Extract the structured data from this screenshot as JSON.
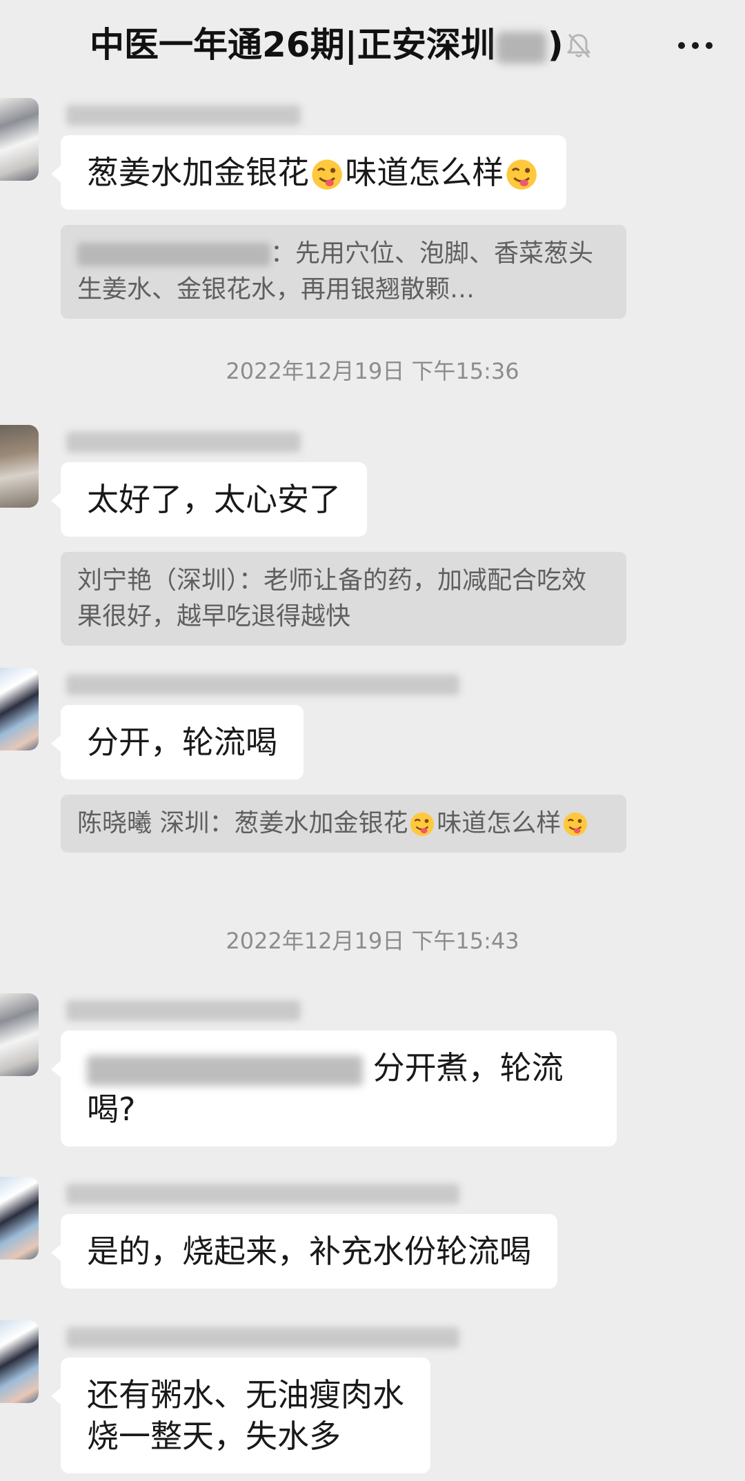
{
  "header": {
    "title": "中医一年通26期|正安深圳",
    "title_close": ")",
    "mute_icon": "bell-off-icon",
    "more_icon": "more-dots-icon"
  },
  "colors": {
    "background": "#ededed",
    "bubble": "#ffffff",
    "quote_bg": "#dcdcdc",
    "timestamp_text": "#8c8c8c"
  },
  "messages": [
    {
      "segments": [
        "葱姜水加金银花",
        "味道怎么样"
      ],
      "emojis": [
        "winking-tongue-emoji",
        "winking-tongue-emoji"
      ],
      "quote": {
        "text": "：先用穴位、泡脚、香菜葱头生姜水、金银花水，再用银翘散颗…"
      }
    },
    {
      "text": "太好了，太心安了",
      "quote": {
        "sender": "刘宁艳（深圳）：",
        "text": "老师让备的药，加减配合吃效果很好，越早吃退得越快"
      }
    },
    {
      "text": "分开，轮流喝",
      "quote": {
        "sender": "陈晓曦 深圳：",
        "segments": [
          "葱姜水加金银花",
          "味道怎么样"
        ]
      }
    },
    {
      "text": "分开煮，轮流喝?"
    },
    {
      "text": "是的，烧起来，补充水份轮流喝"
    },
    {
      "lines": [
        "还有粥水、无油瘦肉水",
        "烧一整天，失水多"
      ]
    }
  ],
  "timestamps": [
    "2022年12月19日 下午15:36",
    "2022年12月19日 下午15:43"
  ]
}
